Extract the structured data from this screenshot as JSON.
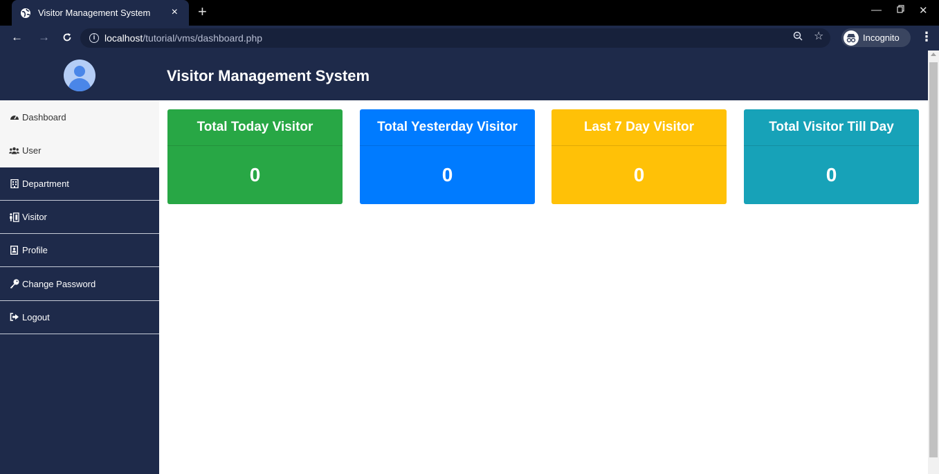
{
  "browser": {
    "tab_title": "Visitor Management System",
    "tab_close": "×",
    "new_tab": "+",
    "url_host": "localhost",
    "url_path": "/tutorial/vms/dashboard.php",
    "profile_label": "Incognito"
  },
  "app": {
    "title": "Visitor Management System"
  },
  "sidebar": {
    "items": [
      {
        "label": "Dashboard",
        "icon": "dashboard-icon"
      },
      {
        "label": "User",
        "icon": "users-icon"
      },
      {
        "label": "Department",
        "icon": "building-icon"
      },
      {
        "label": "Visitor",
        "icon": "visitor-icon"
      },
      {
        "label": "Profile",
        "icon": "profile-card-icon"
      },
      {
        "label": "Change Password",
        "icon": "key-icon"
      },
      {
        "label": "Logout",
        "icon": "sign-out-icon"
      }
    ]
  },
  "cards": [
    {
      "title": "Total Today Visitor",
      "value": "0",
      "color": "#28a745"
    },
    {
      "title": "Total Yesterday Visitor",
      "value": "0",
      "color": "#007bff"
    },
    {
      "title": "Last 7 Day Visitor",
      "value": "0",
      "color": "#ffc107"
    },
    {
      "title": "Total Visitor Till Day",
      "value": "0",
      "color": "#17a2b8"
    }
  ],
  "colors": {
    "navy": "#1e2a4a",
    "sidebar_light": "#f6f6f6"
  }
}
